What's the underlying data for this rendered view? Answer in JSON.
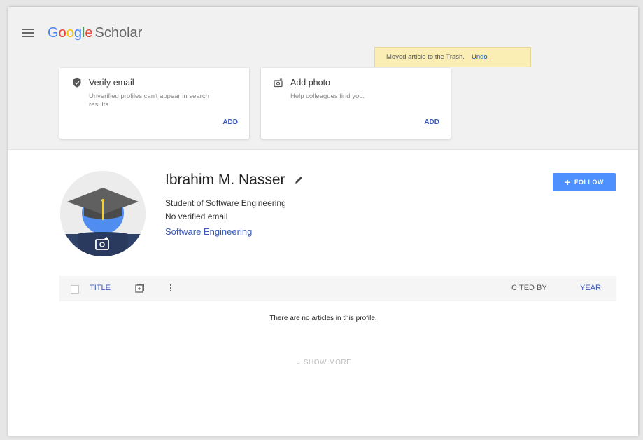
{
  "header": {
    "logo_letters": [
      "G",
      "o",
      "o",
      "g",
      "l",
      "e"
    ],
    "logo_product": "Scholar"
  },
  "snackbar": {
    "message": "Moved article to the Trash.",
    "action": "Undo"
  },
  "cards": [
    {
      "title": "Verify email",
      "description": "Unverified profiles can't appear in search results.",
      "action": "ADD",
      "icon": "shield-check-icon"
    },
    {
      "title": "Add photo",
      "description": "Help colleagues find you.",
      "action": "ADD",
      "icon": "add-photo-icon"
    }
  ],
  "profile": {
    "name": "Ibrahim M. Nasser",
    "affiliation": "Student of Software Engineering",
    "email_status": "No verified email",
    "interest": "Software Engineering",
    "follow_label": "FOLLOW"
  },
  "table": {
    "title_col": "TITLE",
    "cited_col": "CITED BY",
    "year_col": "YEAR",
    "empty_message": "There are no articles in this profile.",
    "show_more": "SHOW MORE"
  },
  "colors": {
    "link": "#3b5bb8",
    "follow_button": "#4d90fe",
    "snackbar_bg": "#fbeeb5"
  }
}
